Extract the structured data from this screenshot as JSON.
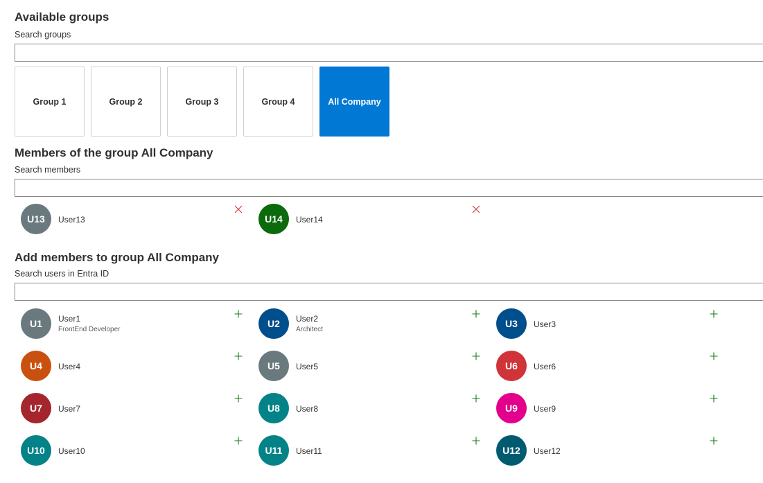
{
  "available": {
    "title": "Available groups",
    "search_label": "Search groups",
    "search_value": "",
    "groups": [
      {
        "label": "Group 1",
        "selected": false
      },
      {
        "label": "Group 2",
        "selected": false
      },
      {
        "label": "Group 3",
        "selected": false
      },
      {
        "label": "Group 4",
        "selected": false
      },
      {
        "label": "All Company",
        "selected": true
      }
    ]
  },
  "members": {
    "title": "Members of the group All Company",
    "search_label": "Search members",
    "search_value": "",
    "action_icon": "remove-icon",
    "items": [
      {
        "initials": "U13",
        "name": "User13",
        "color": "#69797e"
      },
      {
        "initials": "U14",
        "name": "User14",
        "color": "#0b6a0b"
      }
    ]
  },
  "add": {
    "title": "Add members to group All Company",
    "search_label": "Search users in Entra ID",
    "search_value": "",
    "action_icon": "add-icon",
    "items": [
      {
        "initials": "U1",
        "name": "User1",
        "subtitle": "FrontEnd Developer",
        "color": "#69797e"
      },
      {
        "initials": "U2",
        "name": "User2",
        "subtitle": "Architect",
        "color": "#004e8c"
      },
      {
        "initials": "U3",
        "name": "User3",
        "color": "#004e8c"
      },
      {
        "initials": "U4",
        "name": "User4",
        "color": "#ca5010"
      },
      {
        "initials": "U5",
        "name": "User5",
        "color": "#69797e"
      },
      {
        "initials": "U6",
        "name": "User6",
        "color": "#d13438"
      },
      {
        "initials": "U7",
        "name": "User7",
        "color": "#a4262c"
      },
      {
        "initials": "U8",
        "name": "User8",
        "color": "#038387"
      },
      {
        "initials": "U9",
        "name": "User9",
        "color": "#e3008c"
      },
      {
        "initials": "U10",
        "name": "User10",
        "color": "#038387"
      },
      {
        "initials": "U11",
        "name": "User11",
        "color": "#038387"
      },
      {
        "initials": "U12",
        "name": "User12",
        "color": "#005b70"
      }
    ]
  },
  "colors": {
    "accent": "#0078d4",
    "remove": "#d13438",
    "add": "#107c10"
  }
}
